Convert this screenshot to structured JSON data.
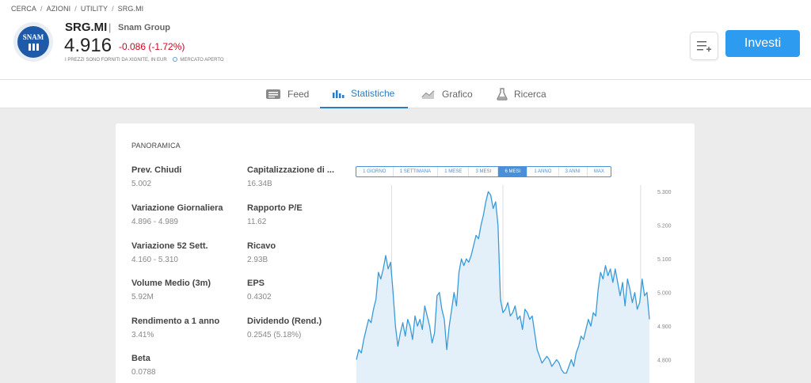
{
  "breadcrumb": [
    "CERCA",
    "AZIONI",
    "UTILITY",
    "SRG.MI"
  ],
  "instrument": {
    "logo_text": "SNAM",
    "symbol": "SRG.MI",
    "separator": "|",
    "company": "Snam Group",
    "price": "4.916",
    "change": "-0.086 (-1.72%)",
    "price_source": "I PREZZI SONO FORNITI DA XIGNITE, IN EUR",
    "market_status": "MERCATO APERTO"
  },
  "actions": {
    "invest_label": "Investi",
    "watchlist_icon": "add-to-list-icon"
  },
  "tabs": [
    {
      "label": "Feed",
      "icon": "feed-icon",
      "active": false
    },
    {
      "label": "Statistiche",
      "icon": "bar-chart-icon",
      "active": true
    },
    {
      "label": "Grafico",
      "icon": "line-chart-icon",
      "active": false
    },
    {
      "label": "Ricerca",
      "icon": "flask-icon",
      "active": false
    }
  ],
  "overview": {
    "title": "PANORAMICA",
    "stats": [
      {
        "label": "Prev. Chiudi",
        "value": "5.002"
      },
      {
        "label": "Variazione Giornaliera",
        "value": "4.896 - 4.989"
      },
      {
        "label": "Variazione 52 Sett.",
        "value": "4.160 - 5.310"
      },
      {
        "label": "Volume Medio (3m)",
        "value": "5.92M"
      },
      {
        "label": "Rendimento a 1 anno",
        "value": "3.41%"
      },
      {
        "label": "Beta",
        "value": "0.0788"
      },
      {
        "label": "Capitalizzazione di ...",
        "value": "16.34B"
      },
      {
        "label": "Rapporto P/E",
        "value": "11.62"
      },
      {
        "label": "Ricavo",
        "value": "2.93B"
      },
      {
        "label": "EPS",
        "value": "0.4302"
      },
      {
        "label": "Dividendo (Rend.)",
        "value": "0.2545 (5.18%)"
      }
    ]
  },
  "ranges": [
    "1 GIORNO",
    "1 SETTIMANA",
    "1 MESE",
    "3 MESI",
    "6 MESI",
    "1 ANNO",
    "3 ANNI",
    "MAX"
  ],
  "active_range": "6 MESI",
  "chart_data": {
    "type": "area",
    "yticks": [
      "5.300",
      "5.200",
      "5.100",
      "5.000",
      "4.900",
      "4.800"
    ],
    "ylim": [
      4.78,
      5.31
    ],
    "color": "#3a9ad9",
    "fill": "#e3f0fa",
    "values": [
      4.8,
      4.83,
      4.82,
      4.86,
      4.89,
      4.92,
      4.91,
      4.95,
      4.98,
      5.06,
      5.04,
      5.07,
      5.11,
      5.07,
      5.09,
      5.0,
      4.9,
      4.84,
      4.88,
      4.91,
      4.87,
      4.92,
      4.9,
      4.86,
      4.93,
      4.9,
      4.92,
      4.89,
      4.96,
      4.93,
      4.9,
      4.85,
      4.88,
      4.99,
      5.0,
      4.95,
      4.92,
      4.83,
      4.9,
      4.95,
      5.0,
      4.96,
      5.06,
      5.1,
      5.08,
      5.1,
      5.09,
      5.11,
      5.14,
      5.17,
      5.16,
      5.2,
      5.23,
      5.27,
      5.3,
      5.29,
      5.25,
      5.27,
      5.2,
      4.98,
      4.94,
      4.95,
      4.97,
      4.93,
      4.94,
      4.96,
      4.92,
      4.93,
      4.89,
      4.95,
      4.94,
      4.92,
      4.93,
      4.88,
      4.83,
      4.81,
      4.79,
      4.8,
      4.81,
      4.8,
      4.78,
      4.79,
      4.8,
      4.79,
      4.77,
      4.76,
      4.76,
      4.78,
      4.8,
      4.78,
      4.82,
      4.84,
      4.87,
      4.86,
      4.89,
      4.92,
      4.9,
      4.94,
      4.93,
      5.01,
      5.06,
      5.04,
      5.08,
      5.05,
      5.07,
      5.03,
      5.07,
      5.03,
      4.99,
      5.03,
      4.96,
      5.04,
      5.01,
      4.97,
      5.0,
      4.95,
      4.97,
      5.04,
      4.99,
      5.0,
      4.92
    ],
    "xgrid_fractions": [
      0.12,
      0.5,
      0.97
    ]
  }
}
